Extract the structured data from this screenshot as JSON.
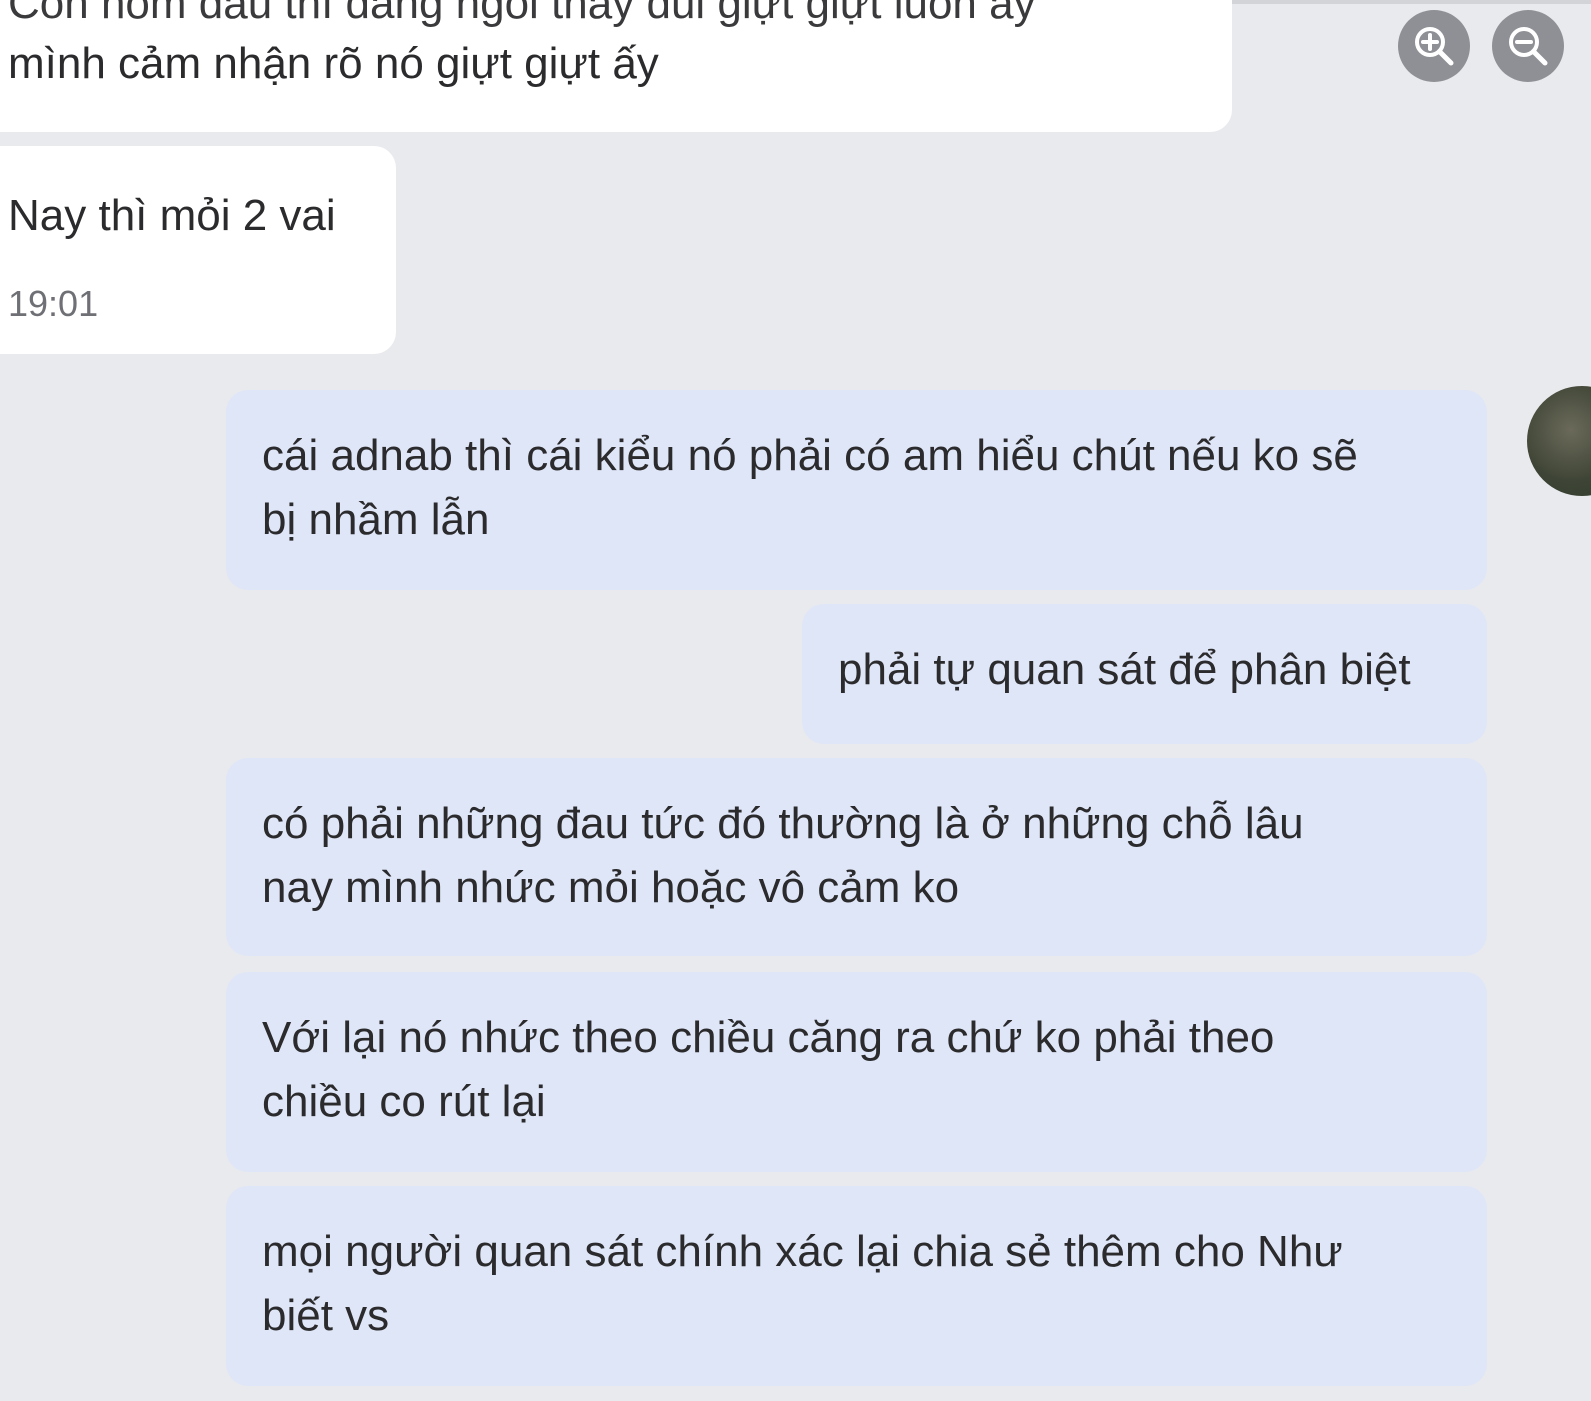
{
  "messages": {
    "incoming": [
      {
        "cut_line": "Còn hôm đầu thì đang ngồi thấy đùi giựt giựt luôn ấy",
        "line": "mình cảm nhận rõ nó giựt giựt ấy"
      },
      {
        "line": "Nay thì mỏi 2 vai",
        "time": "19:01"
      }
    ],
    "outgoing": [
      {
        "lines": [
          "cái adnab thì cái kiểu nó phải có am hiểu chút nếu ko sẽ",
          "bị nhầm lẫn"
        ]
      },
      {
        "lines": [
          "phải tự quan sát để phân biệt"
        ]
      },
      {
        "lines": [
          "có phải những đau tức đó thường là ở những chỗ lâu",
          "nay mình nhức mỏi hoặc vô cảm ko"
        ]
      },
      {
        "lines": [
          "Với lại nó nhức theo chiều căng ra chứ ko phải theo",
          "chiều co rút lại"
        ]
      },
      {
        "lines": [
          "mọi người quan sát chính xác lại chia sẻ thêm cho Như",
          "biết vs"
        ]
      }
    ]
  },
  "controls": {
    "zoom_in_icon": "zoom-in-icon",
    "zoom_out_icon": "zoom-out-icon"
  }
}
